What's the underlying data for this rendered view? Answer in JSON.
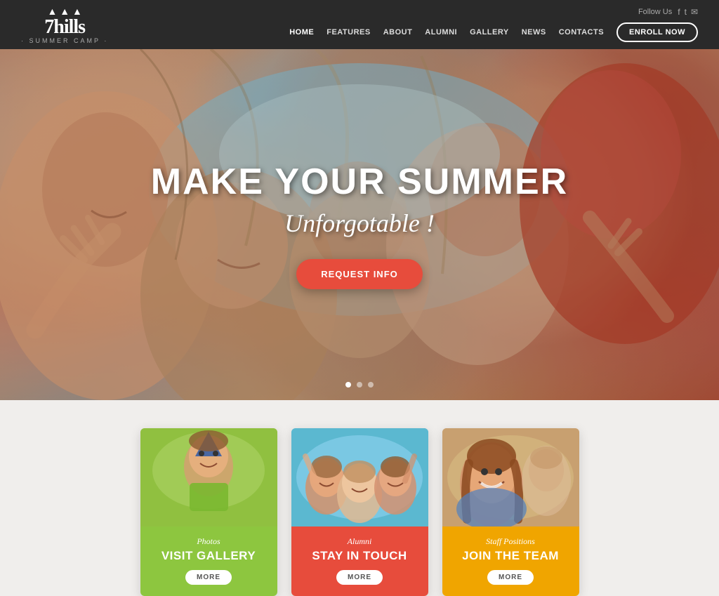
{
  "brand": {
    "logo_number": "7hills",
    "logo_subtitle": "· SUMMER CAMP ·",
    "logo_icon": "▲"
  },
  "header": {
    "follow_us": "Follow Us",
    "enroll_label": "ENROLL NOW",
    "social": [
      "f",
      "t",
      "✉"
    ]
  },
  "nav": {
    "items": [
      {
        "label": "HOME",
        "active": true
      },
      {
        "label": "FEATURES",
        "active": false
      },
      {
        "label": "ABOUT",
        "active": false
      },
      {
        "label": "ALUMNI",
        "active": false
      },
      {
        "label": "GALLERY",
        "active": false
      },
      {
        "label": "NEWS",
        "active": false
      },
      {
        "label": "CONTACTS",
        "active": false
      }
    ]
  },
  "hero": {
    "title": "MAKE YOUR SUMMER",
    "subtitle": "Unforgotable !",
    "cta_label": "REQUEST INFO",
    "dots": [
      1,
      2,
      3
    ]
  },
  "cards": [
    {
      "id": "photos",
      "category": "Photos",
      "title": "VISIT GALLERY",
      "more_label": "MORE",
      "color_class": "card-green",
      "img_class": "img-green"
    },
    {
      "id": "alumni",
      "category": "Alumni",
      "title": "STAY IN TOUCH",
      "more_label": "MORE",
      "color_class": "card-red",
      "img_class": "img-red"
    },
    {
      "id": "staff",
      "category": "Staff Positions",
      "title": "JOIN THE TEAM",
      "more_label": "MORE",
      "color_class": "card-yellow",
      "img_class": "img-yellow"
    }
  ],
  "colors": {
    "header_bg": "#2a2a2a",
    "hero_cta": "#e74c3c",
    "card_green": "#8dc63f",
    "card_red": "#e74c3c",
    "card_yellow": "#f0a500"
  }
}
